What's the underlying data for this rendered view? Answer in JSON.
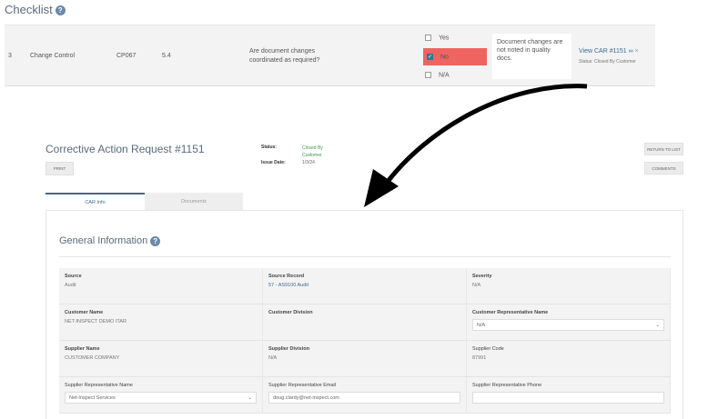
{
  "checklist": {
    "title": "Checklist",
    "row": {
      "number": "3",
      "category": "Change Control",
      "code": "CP067",
      "clause": "5.4",
      "question": "Are document changes coordinated as required?",
      "options": [
        {
          "label": "Yes",
          "checked": false
        },
        {
          "label": "No",
          "checked": true
        },
        {
          "label": "N/A",
          "checked": false
        }
      ],
      "note": "Document changes are not noted in quality docs.",
      "link": "View CAR #1151",
      "status": "Status: Closed By Customer"
    }
  },
  "car": {
    "title": "Corrective Action Request #1151",
    "print": "PRINT",
    "status_label": "Status:",
    "status_value": "Closed By Customer",
    "issue_label": "Issue Date:",
    "issue_value": "1/3/24",
    "return": "RETURN TO LIST",
    "comments": "COMMENTS",
    "tabs": [
      {
        "label": "CAR Info",
        "active": true
      },
      {
        "label": "Documents",
        "active": false
      }
    ],
    "section": "General Information",
    "fields": {
      "source": {
        "label": "Source",
        "value": "Audit"
      },
      "source_record": {
        "label": "Source Record",
        "value": "57 - AS9100 Audit"
      },
      "severity": {
        "label": "Severity",
        "value": "N/A"
      },
      "customer_name": {
        "label": "Customer Name",
        "value": "NET-INSPECT DEMO ITAR"
      },
      "customer_division": {
        "label": "Customer Division",
        "value": ""
      },
      "customer_rep": {
        "label": "Customer Representative Name",
        "value": "N/A"
      },
      "supplier_name": {
        "label": "Supplier Name",
        "value": "CUSTOMER COMPANY"
      },
      "supplier_division": {
        "label": "Supplier Division",
        "value": "N/A"
      },
      "supplier_code": {
        "label": "Supplier Code",
        "value": "87991"
      },
      "supplier_rep": {
        "label": "Supplier Representative Name",
        "value": "Net-Inspect Services"
      },
      "supplier_email": {
        "label": "Supplier Representative Email",
        "value": "doug.clardy@net-inspect.com"
      },
      "supplier_phone": {
        "label": "Supplier Representative Phone",
        "value": ""
      }
    }
  },
  "colors": {
    "accent": "#3d6a96",
    "danger": "#ef6461",
    "success": "#3a9a4a"
  }
}
